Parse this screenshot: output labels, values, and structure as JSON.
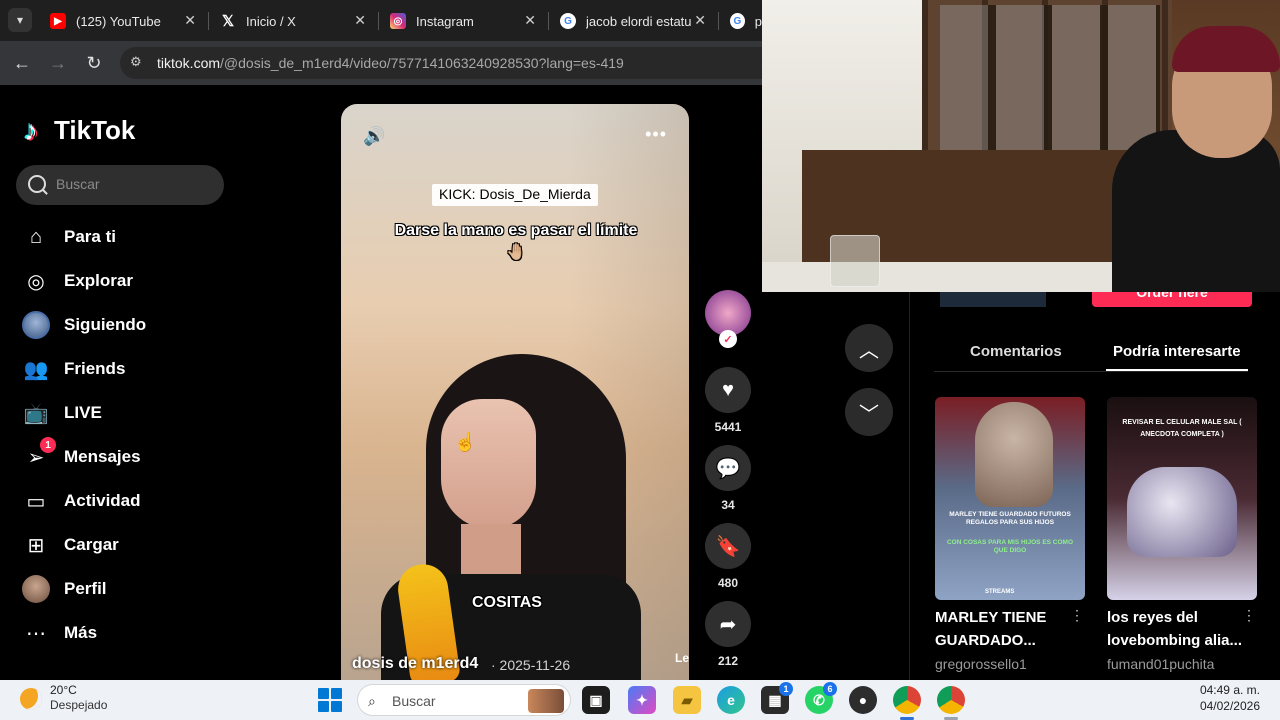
{
  "browser": {
    "tabs": [
      {
        "label": "(125) YouTube",
        "icon": "youtube-icon",
        "color": "#ff0000"
      },
      {
        "label": "Inicio / X",
        "icon": "x-icon",
        "color": "#000000"
      },
      {
        "label": "Instagram",
        "icon": "instagram-icon",
        "color": "#d6249f"
      },
      {
        "label": "jacob elordi estatu",
        "icon": "google-icon",
        "color": "#4285f4"
      },
      {
        "label": "p",
        "icon": "google-icon",
        "color": "#4285f4"
      }
    ],
    "url_domain": "tiktok.com",
    "url_path": "/@dosis_de_m1erd4/video/7577141063240928530?lang=es-419"
  },
  "sidebar": {
    "logo": "TikTok",
    "search_placeholder": "Buscar",
    "items": [
      {
        "label": "Para ti",
        "icon": "home-icon"
      },
      {
        "label": "Explorar",
        "icon": "compass-icon"
      },
      {
        "label": "Siguiendo",
        "icon": "following-avatar"
      },
      {
        "label": "Friends",
        "icon": "friends-icon"
      },
      {
        "label": "LIVE",
        "icon": "live-icon"
      },
      {
        "label": "Mensajes",
        "icon": "messages-icon",
        "badge": "1"
      },
      {
        "label": "Actividad",
        "icon": "activity-icon"
      },
      {
        "label": "Cargar",
        "icon": "upload-icon"
      },
      {
        "label": "Perfil",
        "icon": "profile-avatar"
      },
      {
        "label": "Más",
        "icon": "more-icon"
      }
    ]
  },
  "video": {
    "kick_label": "KICK: Dosis_De_Mierda",
    "caption": "Darse la mano es pasar el límite🤚🏼",
    "subtitle": "COSITAS",
    "author": "dosis de m1erd4",
    "date": "· 2025-11-26",
    "more": "Le"
  },
  "actions": {
    "likes": "5441",
    "comments": "34",
    "saves": "480",
    "shares": "212"
  },
  "right_panel": {
    "order_label": "Order here",
    "tab_comments": "Comentarios",
    "tab_suggestions": "Podría interesarte",
    "recommendations": [
      {
        "title": "MARLEY TIENE GUARDADO...",
        "author": "gregorossello1",
        "thumb_text": "MARLEY TIENE GUARDADO FUTUROS REGALOS PARA SUS HIJOS",
        "thumb_subtext": "CON COSAS PARA MIS HIJOS ES COMO QUE DIGO",
        "thumb_brand": "STREAMS"
      },
      {
        "title": "los reyes del lovebombing alia...",
        "author": "fumand01puchita",
        "thumb_text": "REVISAR EL CELULAR MALE SAL ( ANECDOTA COMPLETA )"
      }
    ]
  },
  "taskbar": {
    "temperature": "20°C",
    "weather": "Despejado",
    "search_label": "Buscar",
    "time": "04:49 a. m.",
    "date": "04/02/2026",
    "badges": {
      "store": "1",
      "whatsapp": "6"
    }
  }
}
